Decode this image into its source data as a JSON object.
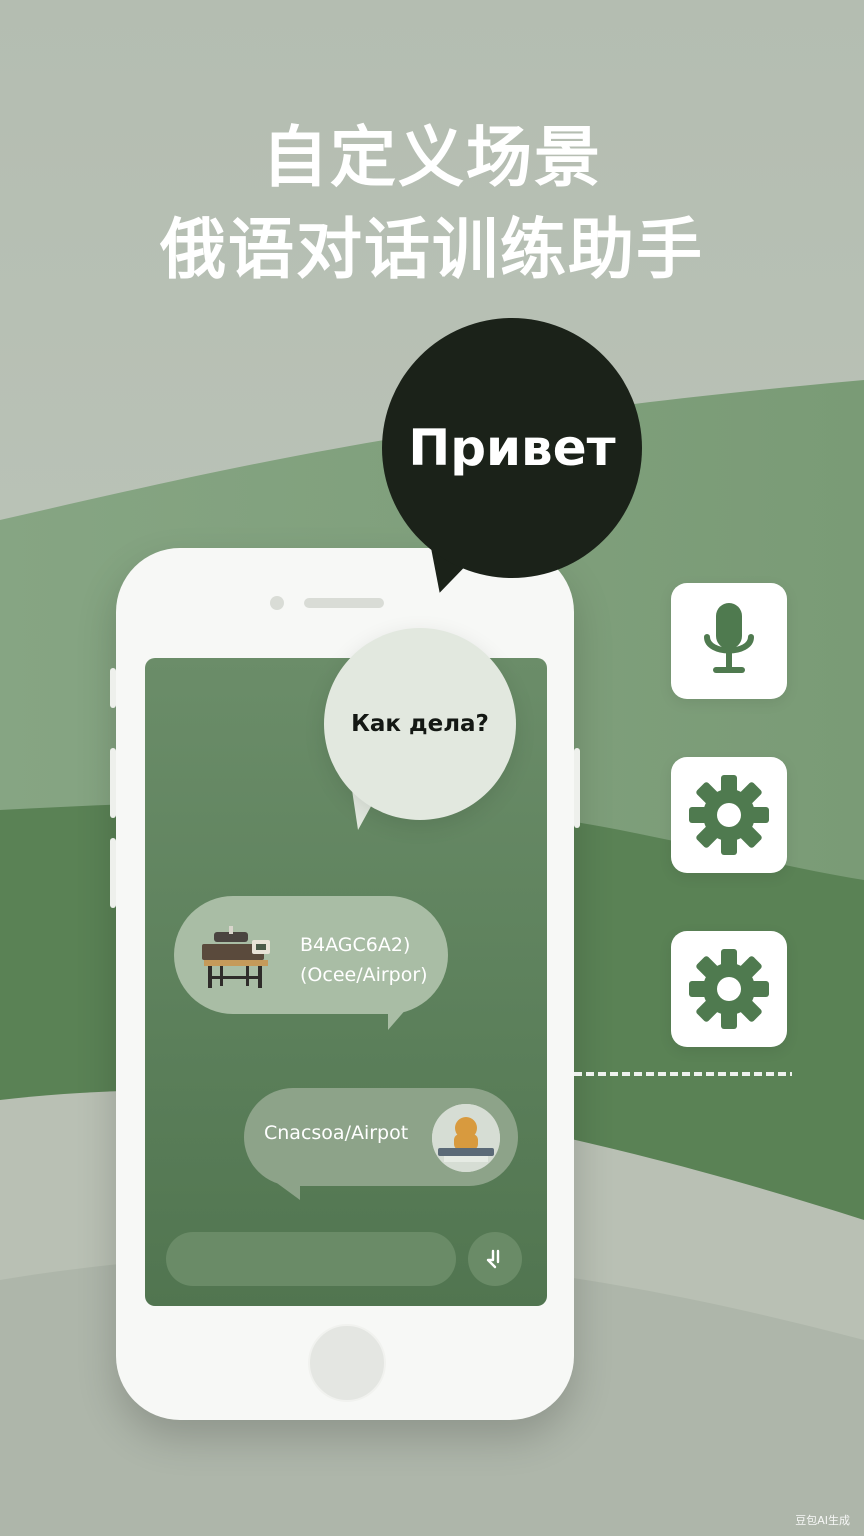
{
  "headline": {
    "line1": "自定义场景",
    "line2": "俄语对话训练助手"
  },
  "bubbles": {
    "greeting": "Привет",
    "question": "Как дела?"
  },
  "chat": {
    "message1_line1": "B4AGC6A2)",
    "message1_line2": "(Ocee/Airpor)",
    "message2": "Cnacsoa/Airpot"
  },
  "tools": [
    {
      "icon": "microphone-icon"
    },
    {
      "icon": "gear-icon"
    },
    {
      "icon": "gear-icon"
    }
  ],
  "watermark": "豆包AI生成",
  "colors": {
    "accent_green": "#4f7a4f",
    "dark_bubble": "#1b2219",
    "background": "#b9c1b6"
  }
}
